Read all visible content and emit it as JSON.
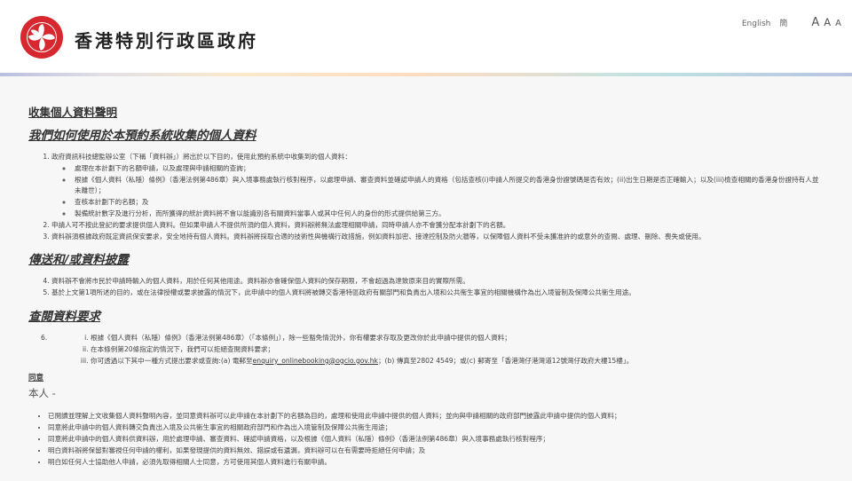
{
  "header": {
    "title": "香港特別行政區政府",
    "logo": "hksar-emblem-bauhinia",
    "lang_english": "English",
    "lang_simplified": "簡",
    "font_size_large": "A",
    "font_size_medium": "A",
    "font_size_small": "A"
  },
  "statement": {
    "title": "收集個人資料聲明",
    "section1_title": "我們如何使用於本預約系統收集的個人資料",
    "item1": "政府資訊科技總監辦公室（下稱「資料辦」）將出於以下目的，使用此預約系統中收集到的個人資料：",
    "item1_subs": [
      "處理在本計劃下的名額申請，以及處理與申請相關的查詢；",
      "根據《個人資料（私隱）條例》（香港法例第486章）與入境事務處執行核對程序，以處理申請、審查資料並確認申請人的資格（包括查核(i)申請人所提交的香港身份證號碼是否有效；(ii)出生日期是否正確輸入；以及(iii)檢查相關的香港身份證持有人並未離世）；",
      "查核本計劃下的名額；及",
      "製備統計數字及進行分析，而所獲得的統計資料將不會以能識別各有關資料當事人或其中任何人的身份的形式提供給第三方。"
    ],
    "item2": "申請人可不按此登記的要求提供個人資料。但如果申請人不提供所須的個人資料，資料辦將無法處理相關申請，同時申請人亦不會獲分配本計劃下的名額。",
    "item3": "資料辦須根據政府既定資訊保安要求，安全地持有個人資料。資料辦將採取合適的技術性與機構行政措施，例如資料加密、接達控制及防火牆等，以保障個人資料不受未獲准許的或意外的查閱、處理、刪除、喪失或使用。",
    "section2_title": "傳送和/或資料披露",
    "item4": "資料辦不會將市民於申請時輸入的個人資料，用於任何其他用途。資料辦亦會確保個人資料的保存期限，不會超過為達致原來目的實際所需。",
    "item5": "基於上文第1項所述的目的，或在法律授權或要求披露的情況下，此申請中的個人資料將被轉交香港特區政府有關部門和負責出入境和公共衞生事宜的相關機構作為出入境管制及保障公共衞生用途。",
    "section3_title": "查閱資料要求",
    "item6_number": "6.",
    "item6_subs": [
      "根據《個人資料（私隱）條例》（香港法例第486章）（「本條例」），除一些豁免情況外，你有權要求存取及更改你於此申請中提供的個人資料；",
      "在本條例第20條指定的情況下，我們可以拒絕查閱資料要求；"
    ],
    "item6_iii_before": "你可透過以下其中一種方式提出要求或查詢:(a) 電郵至",
    "item6_iii_email": "enquiry_onlinebooking@ogcio.gov.hk",
    "item6_iii_after": "；(b) 傳真至2802 4549；或(c) 郵寄至「香港灣仔港灣道12號灣仔政府大樓15樓」。"
  },
  "consent": {
    "label": "同意",
    "me": "本人 -",
    "items": [
      "已閱讀並理解上文收集個人資料聲明內容，並同意資料辦可以此申請在本計劃下的名額為目的，處理和使用此申請中提供的個人資料；並向與申請相關的政府部門披露此申請中提供的個人資料；",
      "同意將此申請中的個人資料轉交負責出入境及公共衞生事宜的相關政府部門和作為出入境管制及保障公共衞生用途；",
      "同意將此申請中的個人資料供資料辦，用於處理申請、審查資料、確認申請資格，以及根據《個人資料（私隱）條例》（香港法例第486章）與入境事務處執行核對程序；",
      "明白資料辦將保留對審視任何申請的權利，如果發現提供的資料無效、錯誤或有遺漏，資料辦可以在有需要時拒絕任何申請；及",
      "明白如任何人士協助他人申請，必須先取得相關人士同意，方可使用其個人資料進行有關申請。"
    ]
  },
  "colors": {
    "emblem_red": "#d7282f",
    "page_bg": "#f7f7f7",
    "header_bg": "#ffffff"
  }
}
